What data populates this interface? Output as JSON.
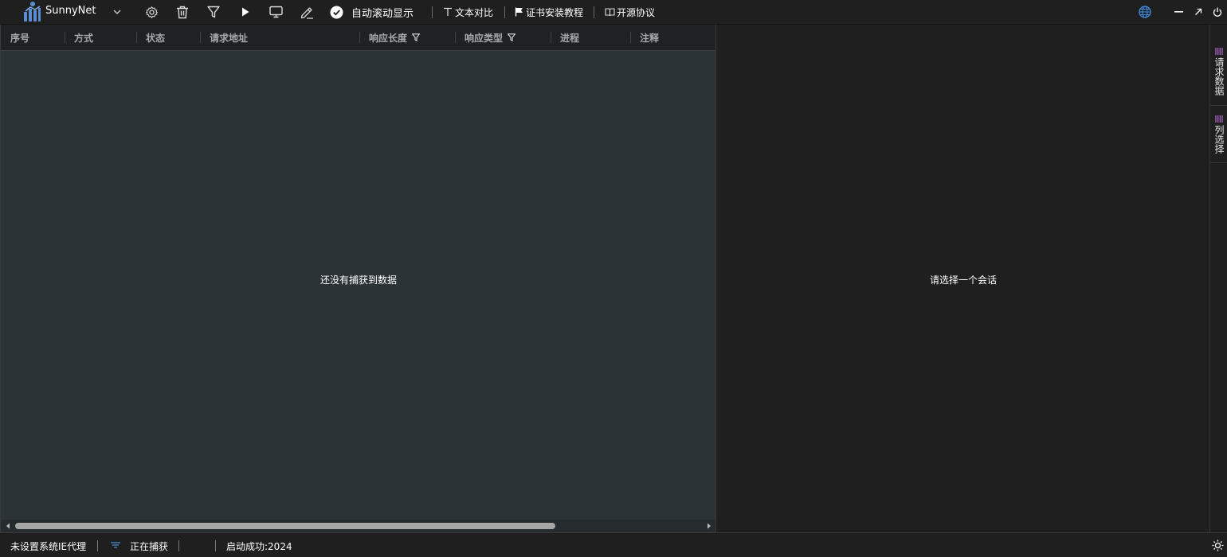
{
  "app": {
    "name": "SunnyNet"
  },
  "toolbar": {
    "auto_scroll_label": "自动滚动显示",
    "text_compare_label": "文本对比",
    "cert_tutorial_label": "证书安装教程",
    "open_source_label": "开源协议"
  },
  "table": {
    "columns": [
      "序号",
      "方式",
      "状态",
      "请求地址",
      "响应长度",
      "响应类型",
      "进程",
      "注释"
    ],
    "empty_message": "还没有捕获到数据"
  },
  "detail": {
    "empty_message": "请选择一个会话"
  },
  "side_tabs": [
    {
      "label": "请求数据"
    },
    {
      "label": "列选择"
    }
  ],
  "status": {
    "proxy_status": "未设置系统IE代理",
    "capture_status": "正在捕获",
    "startup_status": "启动成功:2024"
  },
  "colors": {
    "accent_blue": "#4a8fd6",
    "side_tab_accent": "#b46bd6",
    "list_background": "#2b3336",
    "detail_background": "#1f1f1f"
  }
}
